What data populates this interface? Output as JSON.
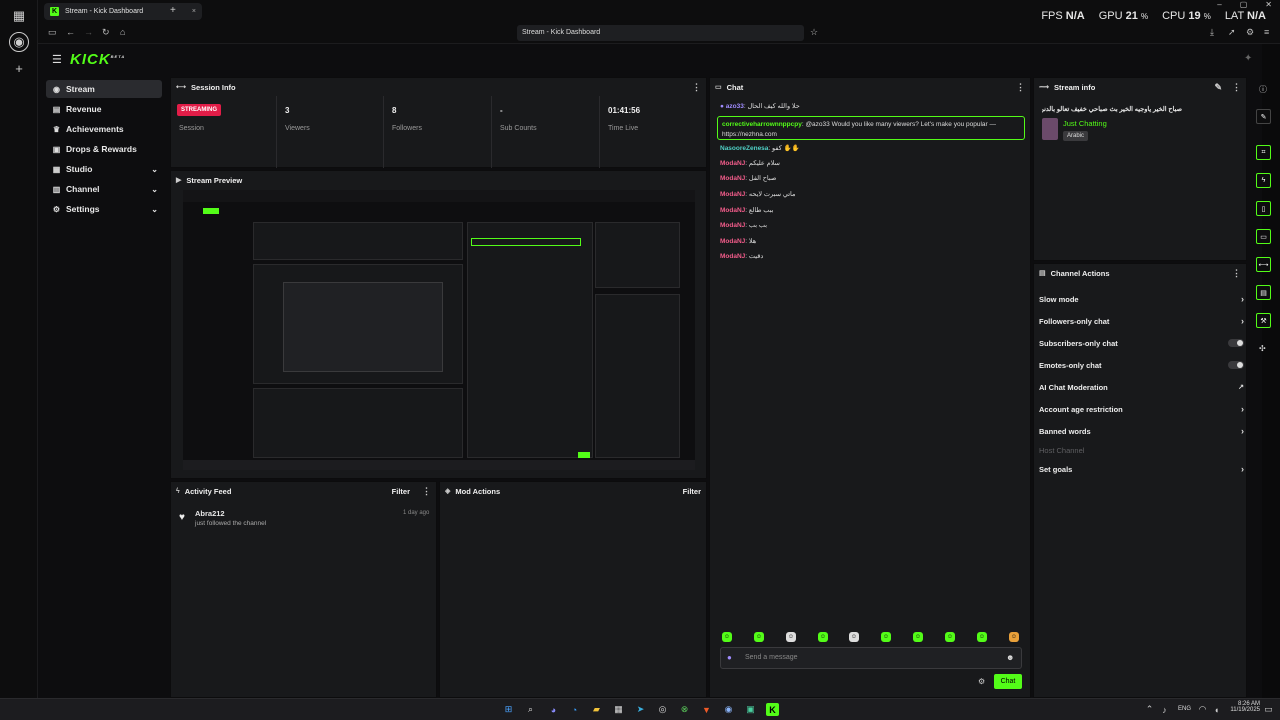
{
  "browser": {
    "tab_title": "Stream - Kick Dashboard",
    "tab_favicon": "K",
    "tab_close": "×",
    "new_tab": "+",
    "url": "Stream - Kick Dashboard"
  },
  "stats": {
    "fps_label": "FPS",
    "fps_value": "N/A",
    "gpu_label": "GPU",
    "gpu_value": "21",
    "cpu_label": "CPU",
    "cpu_value": "19",
    "lat_label": "LAT",
    "lat_value": "N/A",
    "percent": "%"
  },
  "app": {
    "logo": "KICK",
    "logo_sup": "BETA"
  },
  "sidebar": {
    "items": [
      {
        "label": "Stream",
        "icon": "broadcast-icon"
      },
      {
        "label": "Revenue",
        "icon": "revenue-icon"
      },
      {
        "label": "Achievements",
        "icon": "trophy-icon"
      },
      {
        "label": "Drops & Rewards",
        "icon": "gift-icon"
      },
      {
        "label": "Studio",
        "icon": "studio-icon"
      },
      {
        "label": "Channel",
        "icon": "channel-icon"
      },
      {
        "label": "Settings",
        "icon": "gear-icon"
      }
    ]
  },
  "session": {
    "title": "Session Info",
    "status_badge": "STREAMING",
    "status_label": "Session",
    "viewers_value": "3",
    "viewers_label": "Viewers",
    "followers_value": "8",
    "followers_label": "Followers",
    "subs_value": "-",
    "subs_label": "Sub Counts",
    "time_value": "01:41:56",
    "time_label": "Time Live"
  },
  "preview": {
    "title": "Stream Preview"
  },
  "activity": {
    "title": "Activity Feed",
    "filter": "Filter",
    "items": [
      {
        "user": "Abra212",
        "text": "just followed the channel",
        "time": "1 day ago"
      }
    ]
  },
  "mod_actions": {
    "title": "Mod Actions",
    "filter": "Filter"
  },
  "chat": {
    "title": "Chat",
    "messages": [
      {
        "user": "azo33",
        "sep": ":",
        "text": "حلا والله كيف الحال",
        "color": "#a08cff"
      },
      {
        "user": "correctiveharrownnppcpy",
        "sep": ":",
        "text": "@azo33 Would you like many viewers? Let's make you popular — https://nezhna.com",
        "color": "#53fc18"
      },
      {
        "user": "NasooreZenesa",
        "sep": ":",
        "text": "كفو ✋✋",
        "color": "#4fd1c5"
      },
      {
        "user": "ModaNJ",
        "sep": ":",
        "text": "سلام عليكم",
        "color": "#f25c8a"
      },
      {
        "user": "ModaNJ",
        "sep": ":",
        "text": "صباح الفل",
        "color": "#f25c8a"
      },
      {
        "user": "ModaNJ",
        "sep": ":",
        "text": "ماتي سبرت لايحه",
        "color": "#f25c8a"
      },
      {
        "user": "ModaNJ",
        "sep": ":",
        "text": "ببب طالع",
        "color": "#f25c8a"
      },
      {
        "user": "ModaNJ",
        "sep": ":",
        "text": "بب بب",
        "color": "#f25c8a"
      },
      {
        "user": "ModaNJ",
        "sep": ":",
        "text": "هلا",
        "color": "#f25c8a"
      },
      {
        "user": "ModaNJ",
        "sep": ":",
        "text": "دقيت",
        "color": "#f25c8a"
      }
    ],
    "placeholder": "Send a message",
    "send_label": "Chat"
  },
  "stream_info": {
    "title": "Stream info",
    "stream_title": "صباح الخير ياوجيه الخير بث صباحي خفيف تعالو بالدنن",
    "category": "Just Chatting",
    "language": "Arabic"
  },
  "channel_actions": {
    "title": "Channel Actions",
    "rows": [
      {
        "label": "Slow mode",
        "control": "chevron"
      },
      {
        "label": "Followers-only chat",
        "control": "chevron"
      },
      {
        "label": "Subscribers-only chat",
        "control": "toggle"
      },
      {
        "label": "Emotes-only chat",
        "control": "toggle"
      },
      {
        "label": "AI Chat Moderation",
        "control": "external"
      },
      {
        "label": "Account age restriction",
        "control": "chevron"
      },
      {
        "label": "Banned words",
        "control": "chevron"
      },
      {
        "label": "Host Channel",
        "control": "none"
      },
      {
        "label": "Set goals",
        "control": "chevron"
      }
    ]
  },
  "taskbar": {
    "lang": "ENG",
    "time": "8:26 AM",
    "date": "11/19/2025"
  },
  "colors": {
    "accent": "#53fc18",
    "live": "#e21d48",
    "panel": "#18191b"
  }
}
